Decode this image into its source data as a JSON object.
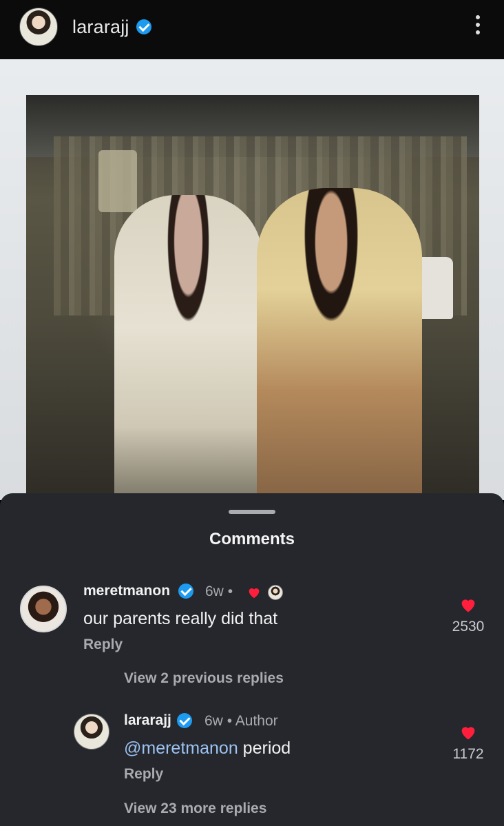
{
  "header": {
    "username": "lararajj",
    "verified": true
  },
  "sheet": {
    "title": "Comments"
  },
  "comments": [
    {
      "username": "meretmanon",
      "verified": true,
      "age": "6w",
      "separator": "•",
      "liked_by_author": true,
      "text": "our parents really did that",
      "reply_label": "Reply",
      "likes": "2530"
    }
  ],
  "view_previous_replies": "View 2 previous replies",
  "replies": [
    {
      "username": "lararajj",
      "verified": true,
      "age": "6w",
      "separator": "•",
      "badge": "Author",
      "mention": "@meretmanon",
      "text": " period",
      "reply_label": "Reply",
      "likes": "1172"
    }
  ],
  "view_more_replies": "View 23 more replies",
  "colors": {
    "sheet_bg": "#25272c",
    "verified": "#1d9bf0",
    "heart": "#ff1f3d",
    "mention": "#9cc3f3"
  }
}
